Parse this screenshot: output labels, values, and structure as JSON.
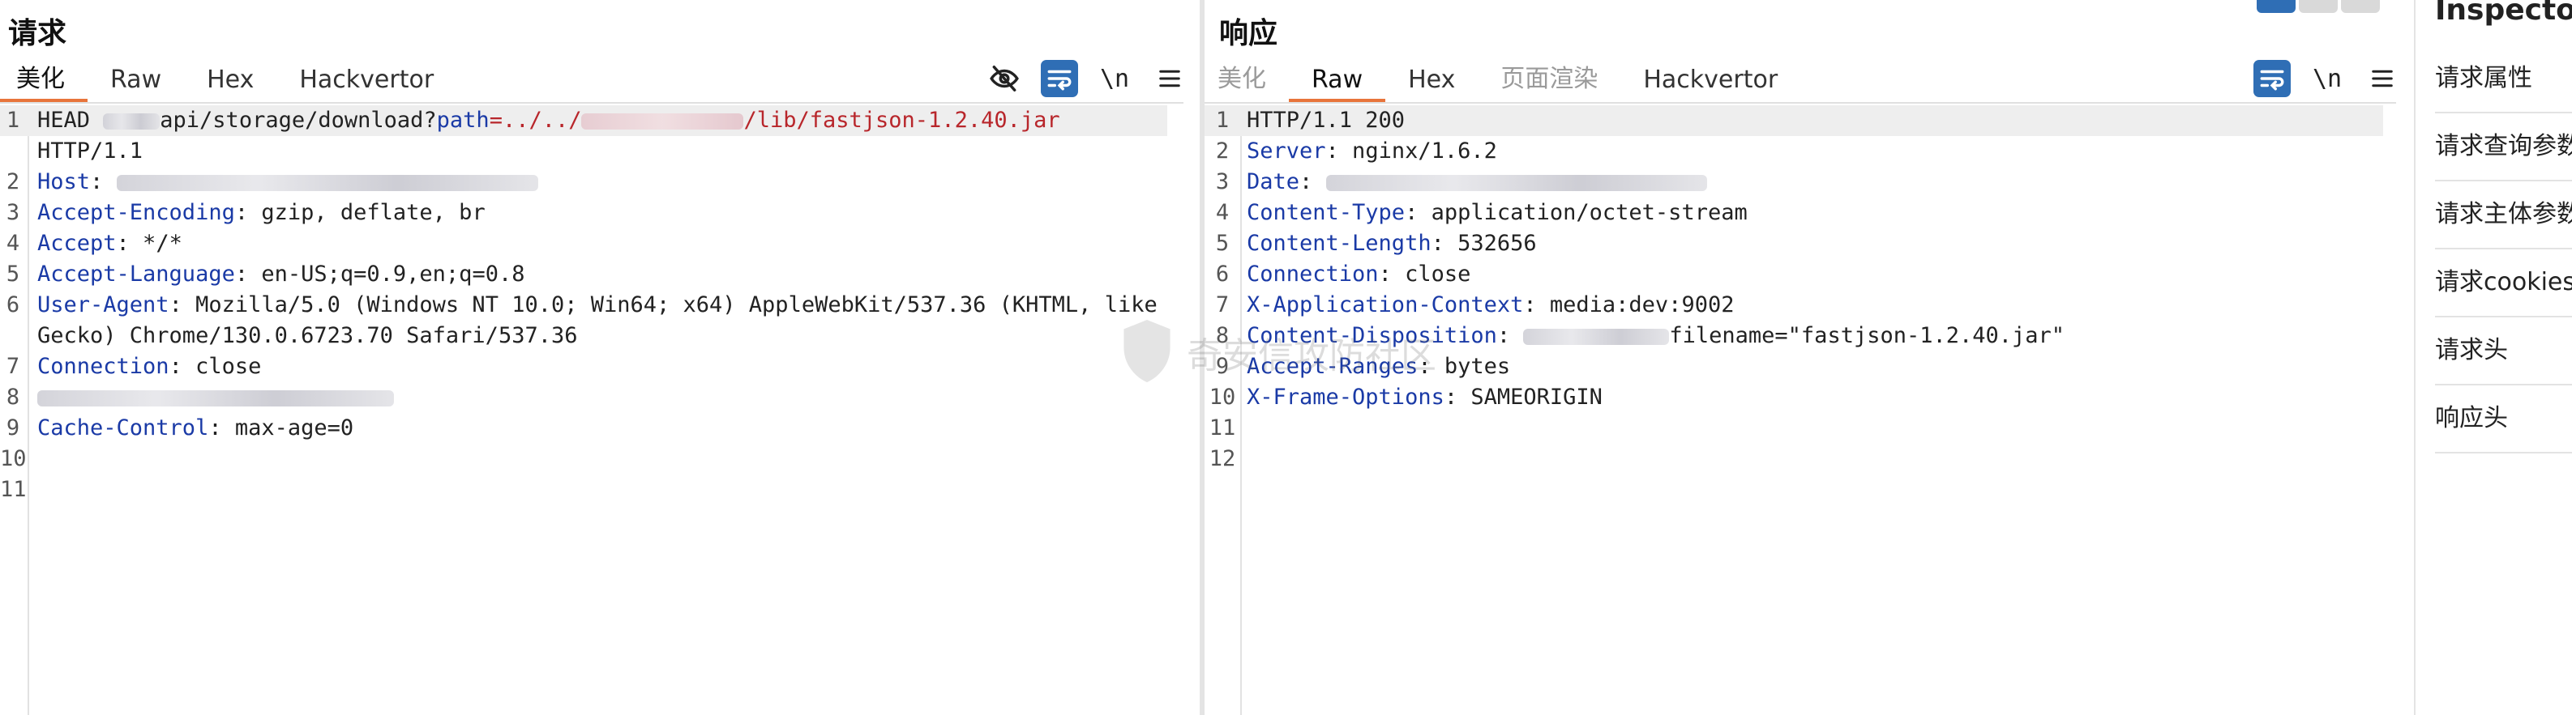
{
  "request": {
    "title": "请求",
    "tabs": [
      "美化",
      "Raw",
      "Hex",
      "Hackvertor"
    ],
    "active_tab": "美化",
    "tools": {
      "newline_label": "\\n"
    },
    "lines": [
      {
        "n": "1",
        "parts": [
          {
            "t": "HEAD ",
            "c": "v"
          },
          {
            "blur": 70
          },
          {
            "t": "api/storage/download?",
            "c": "v"
          },
          {
            "t": "path",
            "c": "k"
          },
          {
            "t": "=../../",
            "c": "p"
          },
          {
            "blur": 200,
            "pink": true
          },
          {
            "t": "/lib/fastjson-1.2.40.jar",
            "c": "p"
          }
        ],
        "hl": true
      },
      {
        "n": "",
        "parts": [
          {
            "t": "HTTP/1.1",
            "c": "v"
          }
        ]
      },
      {
        "n": "2",
        "parts": [
          {
            "t": "Host",
            "c": "k"
          },
          {
            "t": ": ",
            "c": "v"
          },
          {
            "blur": 520
          }
        ]
      },
      {
        "n": "3",
        "parts": [
          {
            "t": "Accept-Encoding",
            "c": "k"
          },
          {
            "t": ": gzip, deflate, br",
            "c": "v"
          }
        ]
      },
      {
        "n": "4",
        "parts": [
          {
            "t": "Accept",
            "c": "k"
          },
          {
            "t": ": */*",
            "c": "v"
          }
        ]
      },
      {
        "n": "5",
        "parts": [
          {
            "t": "Accept-Language",
            "c": "k"
          },
          {
            "t": ": en-US;q=0.9,en;q=0.8",
            "c": "v"
          }
        ]
      },
      {
        "n": "6",
        "parts": [
          {
            "t": "User-Agent",
            "c": "k"
          },
          {
            "t": ": Mozilla/5.0 (Windows NT 10.0; Win64; x64) AppleWebKit/537.36 (KHTML, like",
            "c": "v"
          }
        ]
      },
      {
        "n": "",
        "parts": [
          {
            "t": "Gecko) Chrome/130.0.6723.70 Safari/537.36",
            "c": "v"
          }
        ]
      },
      {
        "n": "7",
        "parts": [
          {
            "t": "Connection",
            "c": "k"
          },
          {
            "t": ": close",
            "c": "v"
          }
        ]
      },
      {
        "n": "8",
        "parts": [
          {
            "blur": 440
          }
        ]
      },
      {
        "n": "9",
        "parts": [
          {
            "t": "Cache-Control",
            "c": "k"
          },
          {
            "t": ": max-age=0",
            "c": "v"
          }
        ]
      },
      {
        "n": "10",
        "parts": []
      },
      {
        "n": "11",
        "parts": []
      }
    ]
  },
  "response": {
    "title": "响应",
    "tabs": [
      "美化",
      "Raw",
      "Hex",
      "页面渲染",
      "Hackvertor"
    ],
    "active_tab": "Raw",
    "disabled_tabs": [
      "美化",
      "页面渲染"
    ],
    "tools": {
      "newline_label": "\\n"
    },
    "lines": [
      {
        "n": "1",
        "parts": [
          {
            "t": "HTTP/1.1 200",
            "c": "v"
          }
        ],
        "hl": true
      },
      {
        "n": "2",
        "parts": [
          {
            "t": "Server",
            "c": "k"
          },
          {
            "t": ": nginx/1.6.2",
            "c": "v"
          }
        ]
      },
      {
        "n": "3",
        "parts": [
          {
            "t": "Date",
            "c": "k"
          },
          {
            "t": ": ",
            "c": "v"
          },
          {
            "blur": 470
          }
        ]
      },
      {
        "n": "4",
        "parts": [
          {
            "t": "Content-Type",
            "c": "k"
          },
          {
            "t": ": application/octet-stream",
            "c": "v"
          }
        ]
      },
      {
        "n": "5",
        "parts": [
          {
            "t": "Content-Length",
            "c": "k"
          },
          {
            "t": ": 532656",
            "c": "v"
          }
        ]
      },
      {
        "n": "6",
        "parts": [
          {
            "t": "Connection",
            "c": "k"
          },
          {
            "t": ": close",
            "c": "v"
          }
        ]
      },
      {
        "n": "7",
        "parts": [
          {
            "t": "X-Application-Context",
            "c": "k"
          },
          {
            "t": ": media:dev:9002",
            "c": "v"
          }
        ]
      },
      {
        "n": "8",
        "parts": [
          {
            "t": "Content-Disposition",
            "c": "k"
          },
          {
            "t": ": ",
            "c": "v"
          },
          {
            "blur": 180
          },
          {
            "t": "filename=\"fastjson-1.2.40.jar\"",
            "c": "v"
          }
        ]
      },
      {
        "n": "9",
        "parts": [
          {
            "t": "Accept-Ranges",
            "c": "k"
          },
          {
            "t": ": bytes",
            "c": "v"
          }
        ]
      },
      {
        "n": "10",
        "parts": [
          {
            "t": "X-Frame-Options",
            "c": "k"
          },
          {
            "t": ": SAMEORIGIN",
            "c": "v"
          }
        ]
      },
      {
        "n": "11",
        "parts": []
      },
      {
        "n": "12",
        "parts": []
      }
    ]
  },
  "inspector": {
    "title": "Inspector",
    "items": [
      "请求属性",
      "请求查询参数",
      "请求主体参数",
      "请求cookies",
      "请求头",
      "响应头"
    ]
  },
  "watermark": {
    "text": "奇安信攻防社区"
  },
  "colors": {
    "accent": "#e8743b",
    "toggle_on": "#2f6eb5",
    "header_key": "#1a3aa6",
    "param_value": "#b8262b"
  },
  "icons": {
    "hide": "eye-off-icon",
    "wrap": "word-wrap-icon",
    "newline": "newline-icon",
    "menu": "hamburger-menu-icon"
  }
}
